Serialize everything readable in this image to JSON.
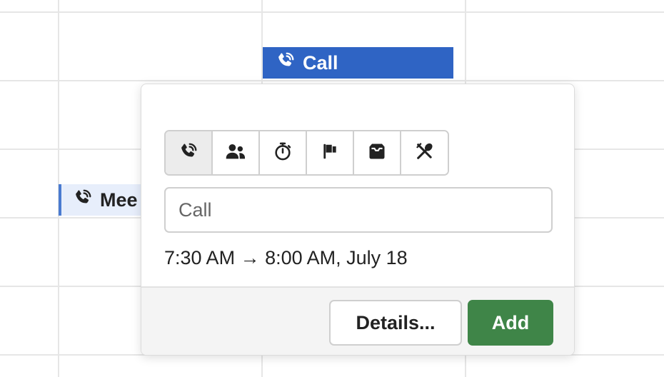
{
  "calendar": {
    "events": {
      "call": {
        "label": "Call",
        "icon": "phone-icon"
      },
      "meeting": {
        "label": "Mee",
        "icon": "phone-icon"
      }
    }
  },
  "popover": {
    "type_buttons": [
      {
        "name": "call",
        "icon": "phone-icon",
        "selected": true
      },
      {
        "name": "meeting",
        "icon": "people-icon",
        "selected": false
      },
      {
        "name": "timer",
        "icon": "stopwatch-icon",
        "selected": false
      },
      {
        "name": "milestone",
        "icon": "flag-icon",
        "selected": false
      },
      {
        "name": "inbox",
        "icon": "inbox-icon",
        "selected": false
      },
      {
        "name": "meal",
        "icon": "utensils-icon",
        "selected": false
      }
    ],
    "title_input": {
      "value": "",
      "placeholder": "Call"
    },
    "time_range": "7:30 AM → 8:00 AM, July 18",
    "details_label": "Details...",
    "add_label": "Add"
  },
  "colors": {
    "event_blue": "#2f64c4",
    "add_green": "#3f8548"
  }
}
